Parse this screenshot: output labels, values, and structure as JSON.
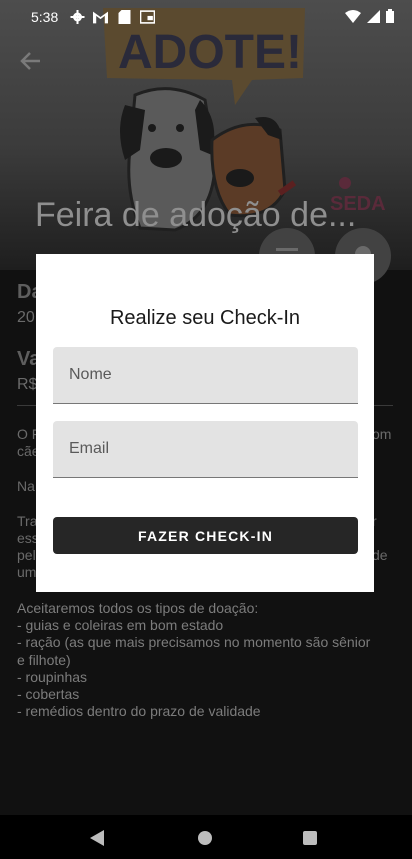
{
  "status_bar": {
    "time": "5:38"
  },
  "event": {
    "title": "Feira de adoção de...",
    "banner_text": "ADOTE!",
    "banner_logo": "SEDA",
    "date_heading": "Da",
    "date_value": "20",
    "value_heading": "Va",
    "value_value": "R$",
    "desc_line1_start": "O F",
    "desc_line1_end": "om",
    "desc_line2": "cãe",
    "desc_line3": "Na",
    "desc_line4_start": "Tra",
    "desc_line4_end": "r",
    "desc_line5": "ess",
    "desc_line6_start": "pel",
    "desc_line6_end": "de",
    "desc_line7": "um",
    "donation_lines": [
      "Aceitaremos todos os tipos de doação:",
      "- guias e coleiras em bom estado",
      "- ração (as que mais precisamos no momento são sênior",
      "e filhote)",
      "- roupinhas",
      "- cobertas",
      "- remédios dentro do prazo de validade"
    ]
  },
  "dialog": {
    "title": "Realize seu Check-In",
    "name_placeholder": "Nome",
    "email_placeholder": "Email",
    "submit_label": "FAZER CHECK-IN"
  }
}
